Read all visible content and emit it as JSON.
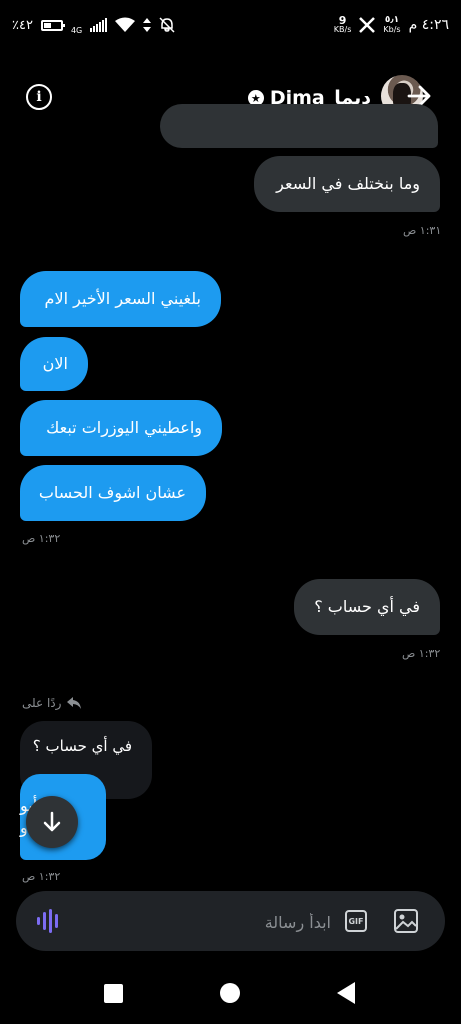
{
  "status_bar": {
    "battery_text": "٪٤٢",
    "network_type": "4G",
    "speed_value_1": "9",
    "speed_unit_1": "KB/s",
    "speed_value_2": "٥٫١",
    "speed_unit_2": "Kb/s",
    "time": "٤:٢٦ م",
    "battery_level": 0.42
  },
  "header": {
    "name": "Dima_ديما"
  },
  "messages": [
    {
      "text": "وما بنختلف في السعر"
    },
    {
      "text": "بلغيني السعر الأخير الام"
    },
    {
      "text": "الان"
    },
    {
      "text": "واعطيني اليوزرات تبعك"
    },
    {
      "text": "عشان اشوف الحساب"
    },
    {
      "text": "في أي حساب ؟"
    },
    {
      "text": "أيو"
    },
    {
      "text": "و"
    }
  ],
  "times": [
    "١:٣١ ص",
    "١:٣٢ ص",
    "١:٣٢ ص",
    "١:٣٢ ص"
  ],
  "reply": {
    "label": "ردًا على",
    "quoted_text": "في أي حساب ؟"
  },
  "composer": {
    "placeholder": "ابدأ رسالة",
    "gif_label": "GIF"
  },
  "colors": {
    "incoming_bubble": "#1d9bf0",
    "outgoing_bubble": "#2f3336",
    "composer_bg": "#202327",
    "voice_icon": "#7c6cf2"
  }
}
